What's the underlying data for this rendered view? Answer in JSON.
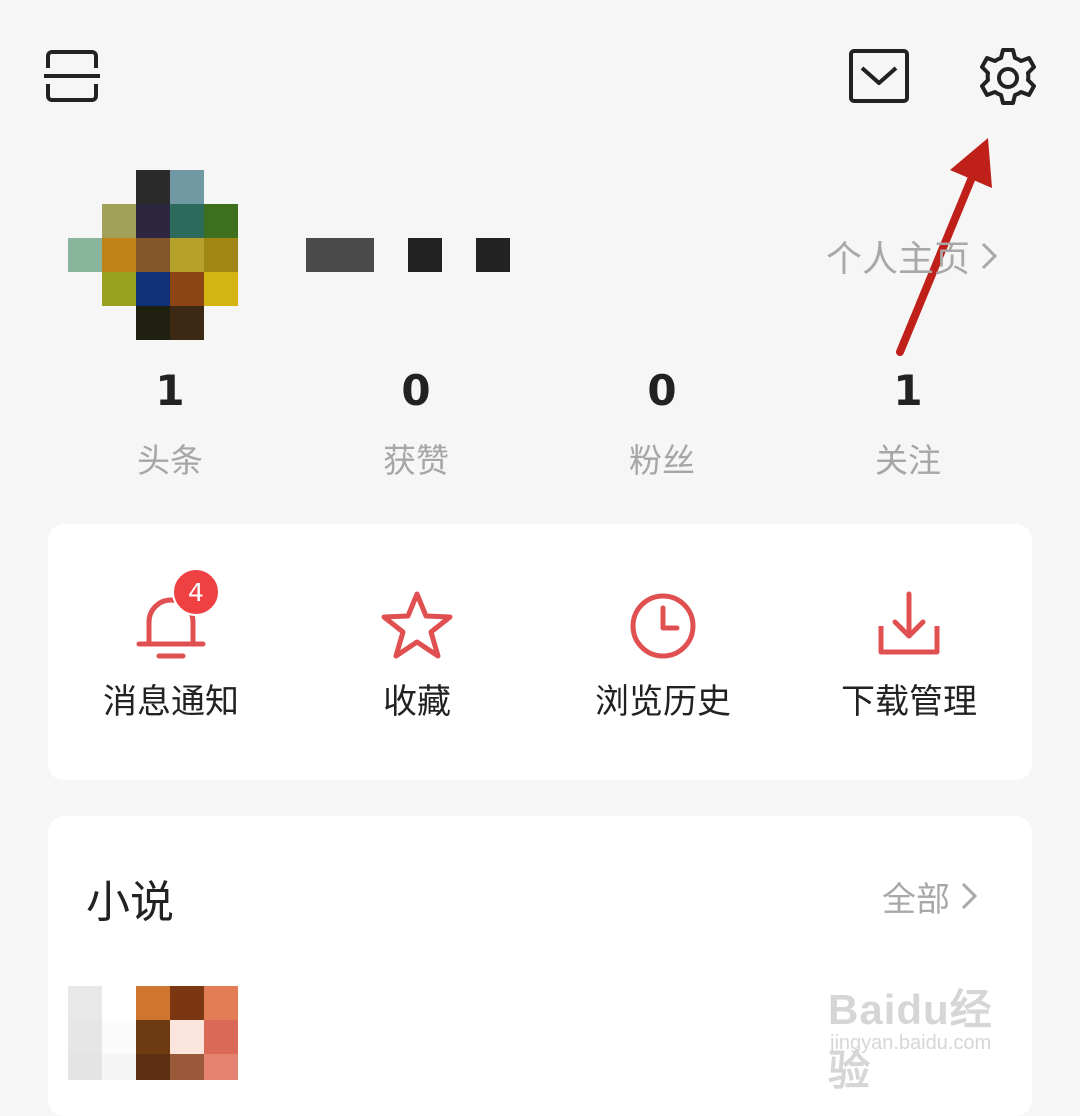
{
  "header": {
    "scan_icon": "scan-icon",
    "mail_icon": "mail-icon",
    "settings_icon": "gear-icon"
  },
  "profile": {
    "avatar": "pixelated-avatar",
    "profile_link_label": "个人主页"
  },
  "stats": [
    {
      "value": "1",
      "label": "头条"
    },
    {
      "value": "0",
      "label": "获赞"
    },
    {
      "value": "0",
      "label": "粉丝"
    },
    {
      "value": "1",
      "label": "关注"
    }
  ],
  "actions": [
    {
      "label": "消息通知",
      "icon": "bell-icon",
      "badge": "4"
    },
    {
      "label": "收藏",
      "icon": "star-icon"
    },
    {
      "label": "浏览历史",
      "icon": "clock-icon"
    },
    {
      "label": "下载管理",
      "icon": "download-icon"
    }
  ],
  "novel": {
    "title": "小说",
    "all_label": "全部"
  },
  "watermark": {
    "main": "Baidu经验",
    "sub": "jingyan.baidu.com"
  },
  "colors": {
    "accent": "#f04142",
    "icon_red": "#e05050",
    "annotation_arrow": "#c0201a",
    "muted_text": "#a8a8a8"
  }
}
